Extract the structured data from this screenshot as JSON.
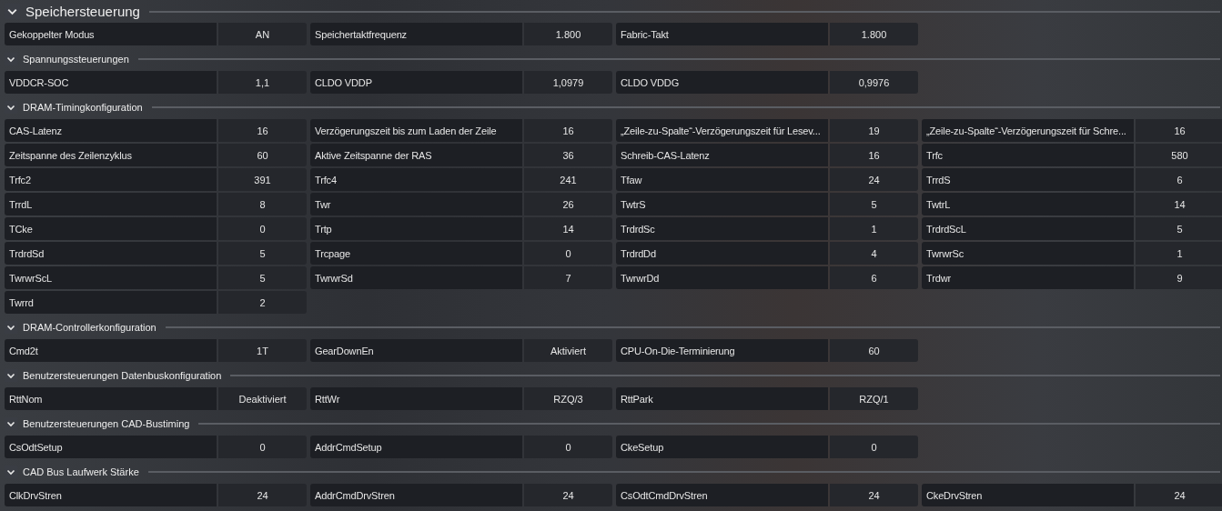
{
  "sections": [
    {
      "title": "Speichersteuerung",
      "expanded": true,
      "kind": "main",
      "items": [
        {
          "label": "Gekoppelter Modus",
          "value": "AN"
        },
        {
          "label": "Speichertaktfrequenz",
          "value": "1.800"
        },
        {
          "label": "Fabric-Takt",
          "value": "1.800"
        }
      ]
    },
    {
      "title": "Spannungssteuerungen",
      "expanded": true,
      "kind": "sub",
      "items": [
        {
          "label": "VDDCR-SOC",
          "value": "1,1"
        },
        {
          "label": "CLDO VDDP",
          "value": "1,0979"
        },
        {
          "label": "CLDO VDDG",
          "value": "0,9976"
        }
      ]
    },
    {
      "title": "DRAM-Timingkonfiguration",
      "expanded": true,
      "kind": "sub",
      "items": [
        {
          "label": "CAS-Latenz",
          "value": "16"
        },
        {
          "label": "Verzögerungszeit bis zum Laden der Zeile",
          "value": "16"
        },
        {
          "label": "„Zeile-zu-Spalte“-Verzögerungszeit für Lesev...",
          "value": "19"
        },
        {
          "label": "„Zeile-zu-Spalte“-Verzögerungszeit für Schre...",
          "value": "16"
        },
        {
          "label": "Zeitspanne des Zeilenzyklus",
          "value": "60"
        },
        {
          "label": "Aktive Zeitspanne der RAS",
          "value": "36"
        },
        {
          "label": "Schreib-CAS-Latenz",
          "value": "16"
        },
        {
          "label": "Trfc",
          "value": "580"
        },
        {
          "label": "Trfc2",
          "value": "391"
        },
        {
          "label": "Trfc4",
          "value": "241"
        },
        {
          "label": "Tfaw",
          "value": "24"
        },
        {
          "label": "TrrdS",
          "value": "6"
        },
        {
          "label": "TrrdL",
          "value": "8"
        },
        {
          "label": "Twr",
          "value": "26"
        },
        {
          "label": "TwtrS",
          "value": "5"
        },
        {
          "label": "TwtrL",
          "value": "14"
        },
        {
          "label": "TCke",
          "value": "0"
        },
        {
          "label": "Trtp",
          "value": "14"
        },
        {
          "label": "TrdrdSc",
          "value": "1"
        },
        {
          "label": "TrdrdScL",
          "value": "5"
        },
        {
          "label": "TrdrdSd",
          "value": "5"
        },
        {
          "label": "Trcpage",
          "value": "0"
        },
        {
          "label": "TrdrdDd",
          "value": "4"
        },
        {
          "label": "TwrwrSc",
          "value": "1"
        },
        {
          "label": "TwrwrScL",
          "value": "5"
        },
        {
          "label": "TwrwrSd",
          "value": "7"
        },
        {
          "label": "TwrwrDd",
          "value": "6"
        },
        {
          "label": "Trdwr",
          "value": "9"
        },
        {
          "label": "Twrrd",
          "value": "2"
        }
      ]
    },
    {
      "title": "DRAM-Controllerkonfiguration",
      "expanded": true,
      "kind": "sub",
      "items": [
        {
          "label": "Cmd2t",
          "value": "1T"
        },
        {
          "label": "GearDownEn",
          "value": "Aktiviert"
        },
        {
          "label": "CPU-On-Die-Terminierung",
          "value": "60"
        }
      ]
    },
    {
      "title": "Benutzersteuerungen Datenbuskonfiguration",
      "expanded": true,
      "kind": "sub",
      "items": [
        {
          "label": "RttNom",
          "value": "Deaktiviert"
        },
        {
          "label": "RttWr",
          "value": "RZQ/3"
        },
        {
          "label": "RttPark",
          "value": "RZQ/1"
        }
      ]
    },
    {
      "title": "Benutzersteuerungen CAD-Bustiming",
      "expanded": true,
      "kind": "sub",
      "items": [
        {
          "label": "CsOdtSetup",
          "value": "0"
        },
        {
          "label": "AddrCmdSetup",
          "value": "0"
        },
        {
          "label": "CkeSetup",
          "value": "0"
        }
      ]
    },
    {
      "title": "CAD Bus Laufwerk Stärke",
      "expanded": true,
      "kind": "sub",
      "items": [
        {
          "label": "ClkDrvStren",
          "value": "24"
        },
        {
          "label": "AddrCmdDrvStren",
          "value": "24"
        },
        {
          "label": "CsOdtCmdDrvStren",
          "value": "24"
        },
        {
          "label": "CkeDrvStren",
          "value": "24"
        }
      ]
    }
  ]
}
